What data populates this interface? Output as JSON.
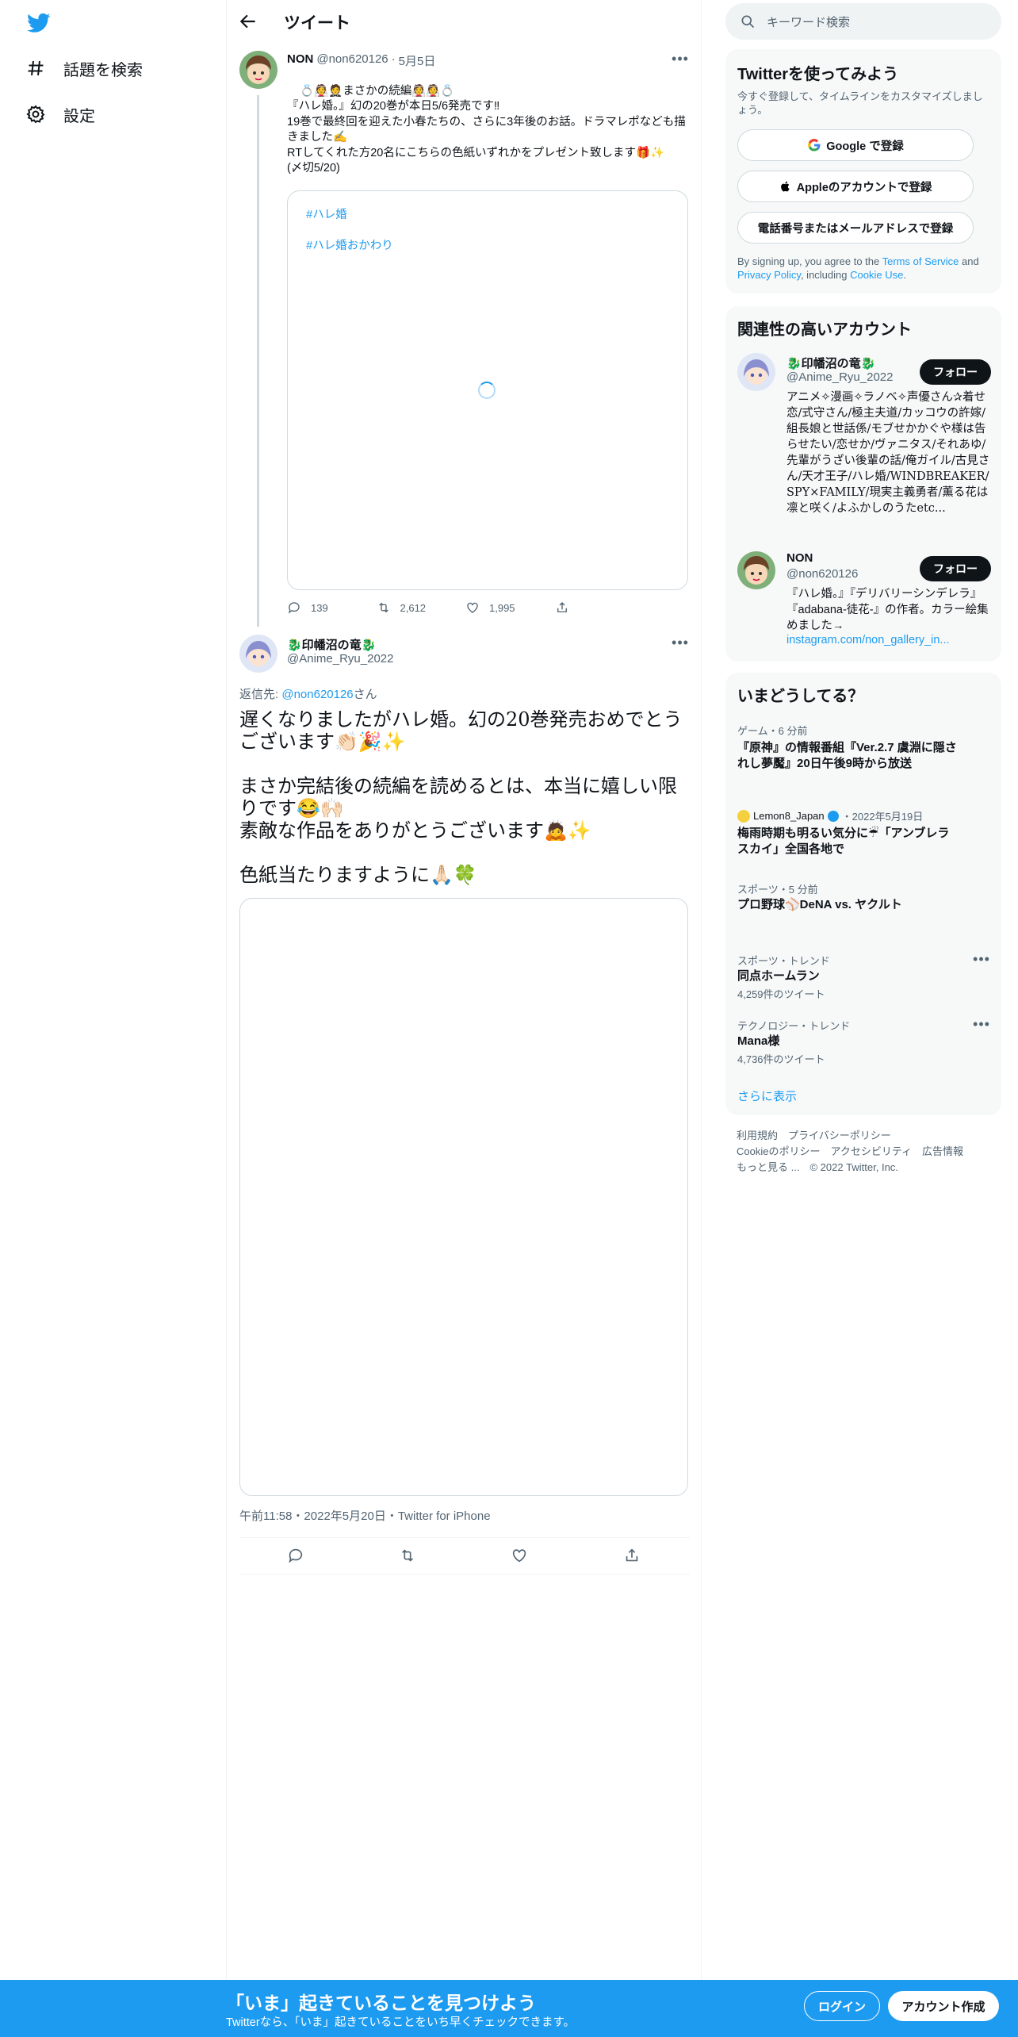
{
  "nav": {
    "explore_label": "話題を検索",
    "settings_label": "設定"
  },
  "header": {
    "title": "ツイート"
  },
  "tweet1": {
    "name": "NON",
    "handle": "@non620126",
    "dot": "·",
    "date": "5月5日",
    "body": "💍👰🤵まさかの続編👰👰💍\n『ハレ婚。』幻の20巻が本日5/6発売です‼\n19巻で最終回を迎えた小春たちの、さらに3年後のお話。ドラマレポなども描きました✍️\nRTしてくれた方20名にこちらの色紙いずれかをプレゼント致します🎁✨\n(〆切5/20)",
    "hashtags": [
      "#ハレ婚",
      "#ハレ婚おかわり"
    ],
    "replies": "139",
    "retweets": "2,612",
    "likes": "1,995"
  },
  "tweet2": {
    "name": "🐉印幡沼の竜🐉",
    "handle": "@Anime_Ryu_2022",
    "reply_prefix": "返信先: ",
    "reply_to": "@non620126",
    "reply_suffix": "さん",
    "body": "遅くなりましたがハレ婚。幻の20巻発売おめでとうございます👏🏻🎉✨\n\nまさか完結後の続編を読めるとは、本当に嬉しい限りです😂🙌🏻\n素敵な作品をありがとうございます🙇✨\n\n色紙当たりますように🙏🏻🍀",
    "meta": "午前11:58・2022年5月20日・Twitter for iPhone"
  },
  "right": {
    "search_placeholder": "キーワード検索",
    "signup": {
      "title": "Twitterを使ってみよう",
      "desc": "今すぐ登録して、タイムラインをカスタマイズしましょう。",
      "google_btn": "Google で登録",
      "apple_btn": "Appleのアカウントで登録",
      "phone_btn": "電話番号またはメールアドレスで登録",
      "legal_1": "By signing up, you agree to the ",
      "tos": "Terms of Service",
      "legal_2": " and ",
      "privacy": "Privacy Policy",
      "legal_3": ", including ",
      "cookie": "Cookie Use",
      "legal_4": "."
    },
    "relevant": {
      "title": "関連性の高いアカウント",
      "accounts": [
        {
          "name": "🐉印幡沼の竜🐉",
          "handle": "@Anime_Ryu_2022",
          "follow": "フォロー",
          "bio": "アニメ✧漫画✧ラノベ✧声優さん✰着せ恋/式守さん/極主夫道/カッコウの許嫁/組長娘と世話係/モブせかかぐや様は告らせたい/恋せか/ヴァニタス/それあゆ/先輩がうざい後輩の話/俺ガイル/古見さん/天才王子/ハレ婚/WINDBREAKER/SPY×FAMILY/現実主義勇者/薫る花は凛と咲く/よふかしのうたetc..."
        },
        {
          "name": "NON",
          "handle": "@non620126",
          "follow": "フォロー",
          "bio": "『ハレ婚。』『デリバリーシンデレラ』『adabana-徒花-』の作者。カラー絵集めました→",
          "link": "instagram.com/non_gallery_in..."
        }
      ]
    },
    "trends": {
      "title": "いまどうしてる？",
      "items": [
        {
          "category": "ゲーム・6 分前",
          "title": "『原神』の情報番組『Ver.2.7 虞淵に隠されし夢魘』20日午後9時から放送"
        },
        {
          "source": "Lemon8_Japan",
          "date": "・2022年5月19日",
          "title": "梅雨時期も明るい気分に☔「アンブレラスカイ」全国各地で"
        },
        {
          "category": "スポーツ・5 分前",
          "title": "プロ野球⚾DeNA vs. ヤクルト"
        },
        {
          "category": "スポーツ・トレンド",
          "title": "同点ホームラン",
          "count": "4,259件のツイート"
        },
        {
          "category": "テクノロジー・トレンド",
          "title": "Mana様",
          "count": "4,736件のツイート"
        }
      ],
      "show_more": "さらに表示"
    },
    "footer": {
      "line1": "利用規約　プライバシーポリシー",
      "line2": "Cookieのポリシー　アクセシビリティ　広告情報",
      "line3": "もっと見る ...　© 2022 Twitter, Inc."
    }
  },
  "bottom": {
    "title": "「いま」起きていることを見つけよう",
    "sub": "Twitterなら、「いま」起きていることをいち早くチェックできます。",
    "login": "ログイン",
    "signup": "アカウント作成"
  },
  "colors": {
    "brand": "#1d9bf0",
    "text": "#0f1419",
    "muted": "#536471"
  }
}
